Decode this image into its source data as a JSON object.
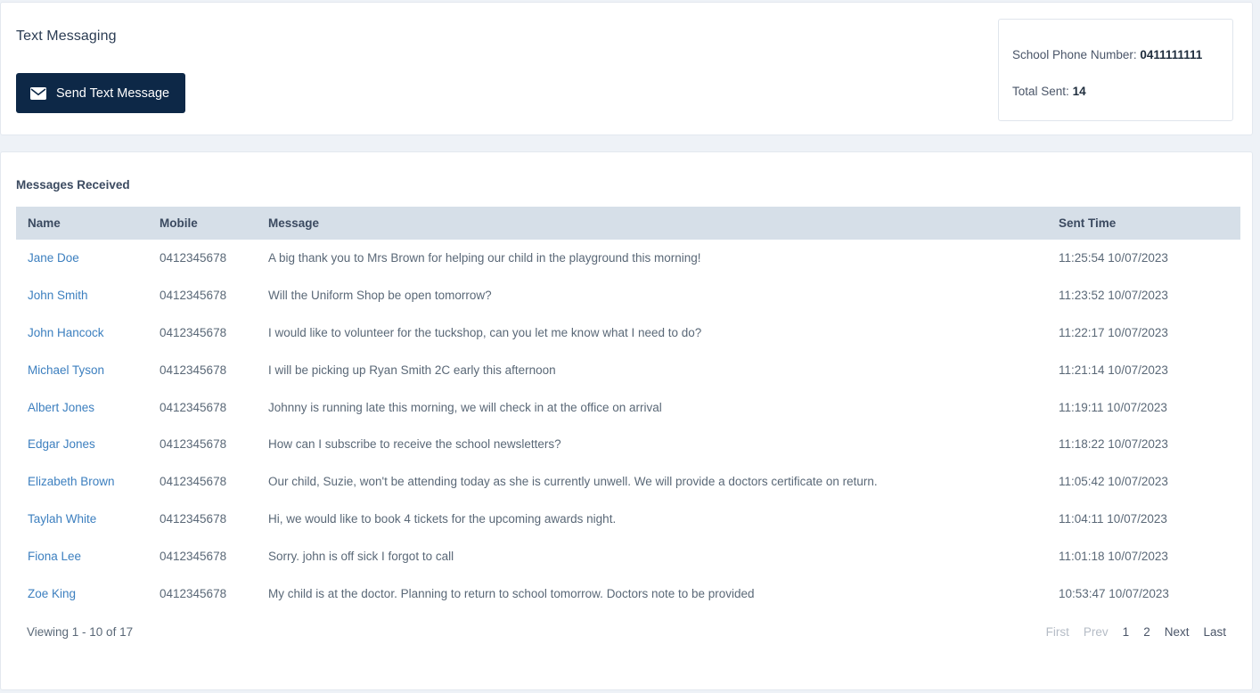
{
  "header": {
    "title": "Text Messaging",
    "send_button": {
      "label": "Send Text Message",
      "icon": "envelope-icon"
    },
    "info": {
      "phone_label": "School Phone Number:",
      "phone_value": "0411111111",
      "total_label": "Total Sent:",
      "total_value": "14"
    }
  },
  "table": {
    "section_title": "Messages Received",
    "columns": [
      "Name",
      "Mobile",
      "Message",
      "Sent Time"
    ],
    "rows": [
      {
        "name": "Jane Doe",
        "mobile": "0412345678",
        "message": "A big thank you to Mrs Brown for helping our child in the playground this morning!",
        "sent_time": "11:25:54 10/07/2023"
      },
      {
        "name": "John Smith",
        "mobile": "0412345678",
        "message": "Will the Uniform Shop be open tomorrow?",
        "sent_time": "11:23:52 10/07/2023"
      },
      {
        "name": "John Hancock",
        "mobile": "0412345678",
        "message": "I would like to volunteer for the tuckshop, can you let me know what I need to do?",
        "sent_time": "11:22:17 10/07/2023"
      },
      {
        "name": "Michael Tyson",
        "mobile": "0412345678",
        "message": "I will be picking up Ryan Smith 2C early this afternoon",
        "sent_time": "11:21:14 10/07/2023"
      },
      {
        "name": "Albert Jones",
        "mobile": "0412345678",
        "message": "Johnny is running late this morning, we will check in at the office on arrival",
        "sent_time": "11:19:11 10/07/2023"
      },
      {
        "name": "Edgar Jones",
        "mobile": "0412345678",
        "message": "How can I subscribe to receive the school newsletters?",
        "sent_time": "11:18:22 10/07/2023"
      },
      {
        "name": "Elizabeth Brown",
        "mobile": "0412345678",
        "message": "Our child, Suzie, won't be attending today as she is currently unwell. We will provide a doctors certificate on return.",
        "sent_time": "11:05:42 10/07/2023"
      },
      {
        "name": "Taylah White",
        "mobile": "0412345678",
        "message": "Hi, we would like to book 4 tickets for the upcoming awards night.",
        "sent_time": "11:04:11 10/07/2023"
      },
      {
        "name": "Fiona Lee",
        "mobile": "0412345678",
        "message": "Sorry. john is off sick I forgot to call",
        "sent_time": "11:01:18 10/07/2023"
      },
      {
        "name": "Zoe King",
        "mobile": "0412345678",
        "message": "My child is at the doctor. Planning to return to school tomorrow. Doctors note to be provided",
        "sent_time": "10:53:47 10/07/2023"
      }
    ]
  },
  "footer": {
    "viewing": "Viewing 1 - 10 of 17",
    "pager": [
      {
        "label": "First",
        "state": "disabled"
      },
      {
        "label": "Prev",
        "state": "disabled"
      },
      {
        "label": "1",
        "state": "active"
      },
      {
        "label": "2",
        "state": "page"
      },
      {
        "label": "Next",
        "state": "link"
      },
      {
        "label": "Last",
        "state": "link"
      }
    ]
  },
  "colors": {
    "page_background": "#eef2f7",
    "card_background": "#ffffff",
    "button_navy": "#0d2847",
    "table_header": "#d6dfe8",
    "link_blue": "#3c7fbf",
    "text_muted": "#5a6877",
    "pager_disabled": "#b5bcc6"
  }
}
